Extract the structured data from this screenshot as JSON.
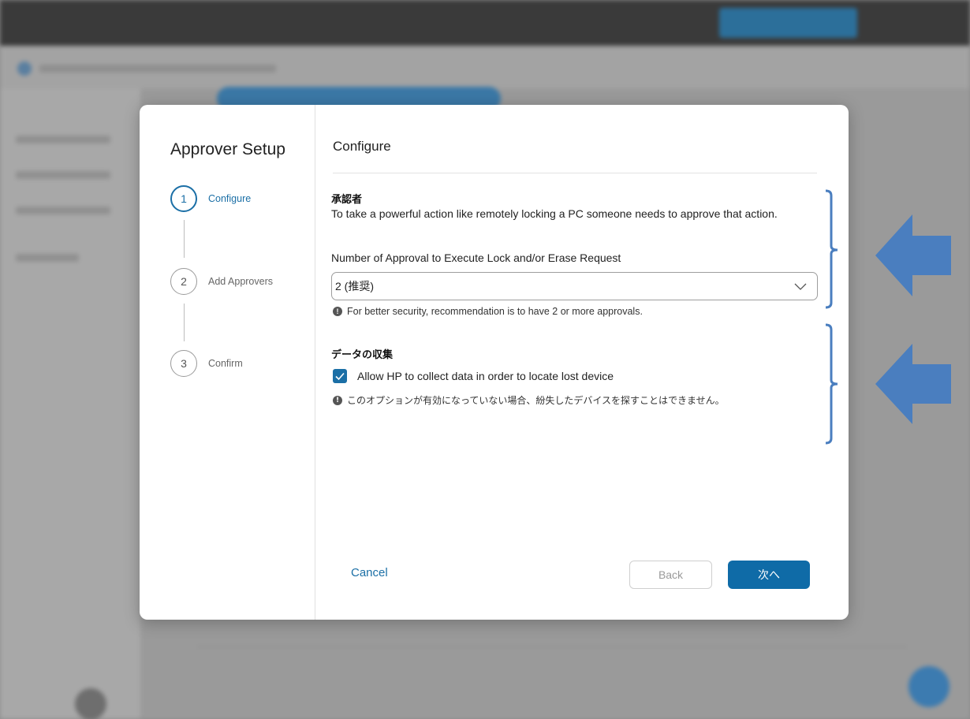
{
  "dialog": {
    "title": "Approver Setup",
    "steps": [
      {
        "number": "1",
        "label": "Configure"
      },
      {
        "number": "2",
        "label": "Add Approvers"
      },
      {
        "number": "3",
        "label": "Confirm"
      }
    ],
    "active_step": 0
  },
  "panel": {
    "title": "Configure",
    "approvers": {
      "heading": "承認者",
      "description": "To take a powerful action like remotely locking a PC someone needs to approve that action.",
      "field_label": "Number of Approval to Execute Lock and/or Erase Request",
      "select_value": "2 (推奨)",
      "info_text": "For better security, recommendation is to have 2 or more approvals."
    },
    "data_collection": {
      "heading": "データの収集",
      "checkbox_label": "Allow HP to collect data in order to locate lost device",
      "checkbox_checked": true,
      "info_text": "このオプションが有効になっていない場合、紛失したデバイスを探すことはできません。"
    }
  },
  "footer": {
    "cancel_label": "Cancel",
    "back_label": "Back",
    "next_label": "次へ"
  },
  "colors": {
    "accent": "#1b6fa6",
    "annotation": "#4a7ebf"
  }
}
